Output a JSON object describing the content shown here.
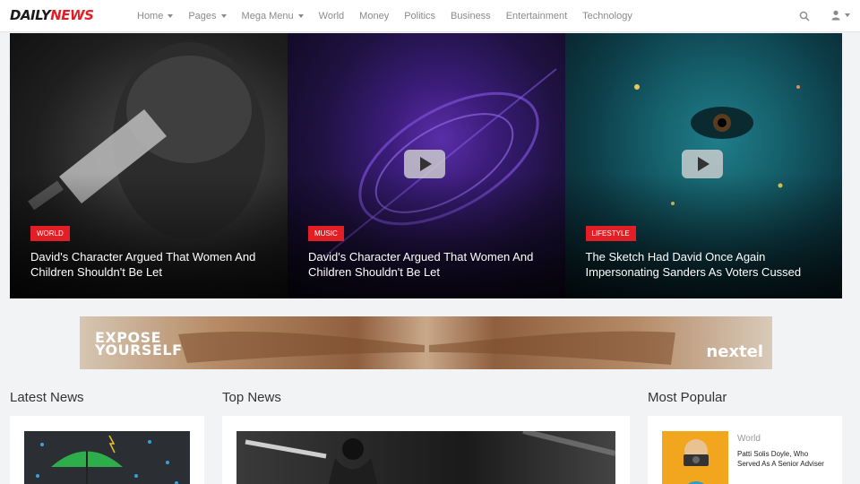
{
  "brand": {
    "logo_part1": "DAILY",
    "logo_part2": "NEWS"
  },
  "nav": {
    "items": [
      "Home",
      "Pages",
      "Mega Menu",
      "World",
      "Money",
      "Politics",
      "Business",
      "Entertainment",
      "Technology"
    ],
    "dropdown_items": [
      "Home",
      "Pages",
      "Mega Menu"
    ],
    "search_icon": "search-icon",
    "user_icon": "user-icon"
  },
  "hero": [
    {
      "category": "WORLD",
      "title": "David's Character Argued That Women And Children Shouldn't Be Let",
      "has_play": false
    },
    {
      "category": "MUSIC",
      "title": "David's Character Argued That Women And Children Shouldn't Be Let",
      "has_play": true
    },
    {
      "category": "LIFESTYLE",
      "title": "The Sketch Had David Once Again Impersonating Sanders As Voters Cussed",
      "has_play": true
    }
  ],
  "ad": {
    "line1": "EXPOSE",
    "line2": "YOURSELF",
    "brand": "nextel"
  },
  "sections": {
    "latest": "Latest News",
    "top": "Top News",
    "popular": "Most Popular"
  },
  "popular_item": {
    "category": "World",
    "title": "Patti Solis Doyle, Who Served As A Senior Adviser"
  },
  "colors": {
    "accent": "#e31e24",
    "nav_text": "#8a8a8a",
    "background": "#f2f3f5"
  }
}
